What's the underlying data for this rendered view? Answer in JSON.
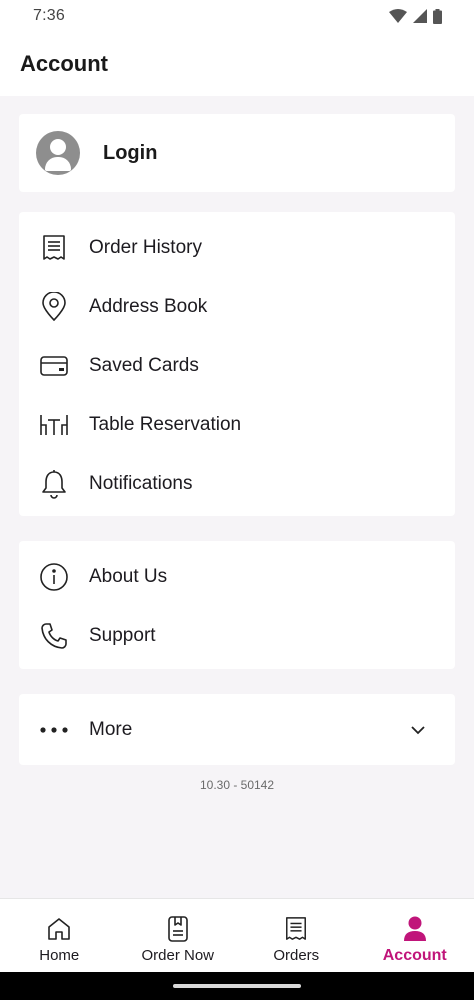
{
  "status_bar": {
    "time": "7:36"
  },
  "header": {
    "title": "Account"
  },
  "login": {
    "label": "Login"
  },
  "menu_primary": [
    {
      "label": "Order History",
      "icon": "receipt-icon"
    },
    {
      "label": "Address Book",
      "icon": "location-pin-icon"
    },
    {
      "label": "Saved Cards",
      "icon": "credit-card-icon"
    },
    {
      "label": "Table Reservation",
      "icon": "table-icon"
    },
    {
      "label": "Notifications",
      "icon": "bell-icon"
    }
  ],
  "menu_secondary": [
    {
      "label": "About Us",
      "icon": "info-icon"
    },
    {
      "label": "Support",
      "icon": "phone-icon"
    }
  ],
  "more": {
    "label": "More",
    "icon": "more-dots-icon"
  },
  "version": "10.30 - 50142",
  "bottom_nav": [
    {
      "label": "Home",
      "icon": "home-icon"
    },
    {
      "label": "Order Now",
      "icon": "menu-book-icon"
    },
    {
      "label": "Orders",
      "icon": "receipt-icon"
    },
    {
      "label": "Account",
      "icon": "person-icon",
      "active": true
    }
  ],
  "colors": {
    "accent": "#c0157a",
    "background": "#f6f4f7",
    "card": "#ffffff"
  }
}
